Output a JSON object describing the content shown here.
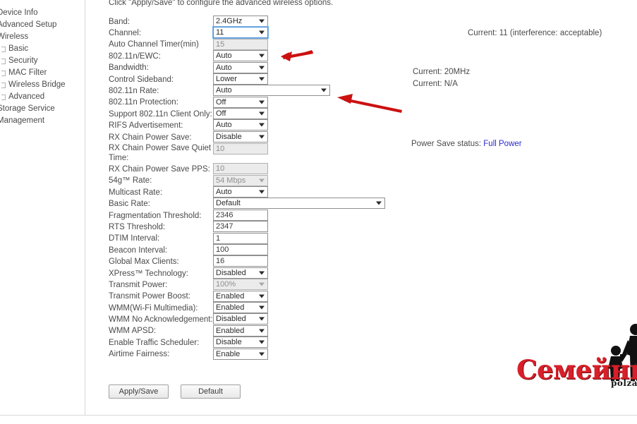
{
  "sidebar": {
    "items": [
      {
        "label": "Device Info",
        "sub": false
      },
      {
        "label": "Advanced Setup",
        "sub": false
      },
      {
        "label": "Wireless",
        "sub": false
      },
      {
        "label": "Basic",
        "sub": true
      },
      {
        "label": "Security",
        "sub": true
      },
      {
        "label": "MAC Filter",
        "sub": true
      },
      {
        "label": "Wireless Bridge",
        "sub": true
      },
      {
        "label": "Advanced",
        "sub": true
      },
      {
        "label": "Storage Service",
        "sub": false
      },
      {
        "label": "Management",
        "sub": false
      }
    ]
  },
  "main": {
    "intro": "Click \"Apply/Save\" to configure the advanced wireless options.",
    "notes": {
      "channel_current": "Current: 11 (interference: acceptable)",
      "bandwidth_current": "Current: 20MHz",
      "sideband_current": "Current: N/A",
      "power_save_prefix": "Power Save status: ",
      "power_save_link": "Full Power"
    },
    "fields": [
      {
        "label": "Band:",
        "type": "select",
        "value": "2.4GHz",
        "width": "normal",
        "state": "normal"
      },
      {
        "label": "Channel:",
        "type": "select",
        "value": "11",
        "width": "normal",
        "state": "focused"
      },
      {
        "label": "Auto Channel Timer(min)",
        "type": "input",
        "value": "15",
        "width": "normal",
        "state": "disabled"
      },
      {
        "label": "802.11n/EWC:",
        "type": "select",
        "value": "Auto",
        "width": "normal",
        "state": "normal"
      },
      {
        "label": "Bandwidth:",
        "type": "select",
        "value": "Auto",
        "width": "normal",
        "state": "normal"
      },
      {
        "label": "Control Sideband:",
        "type": "select",
        "value": "Lower",
        "width": "normal",
        "state": "normal"
      },
      {
        "label": "802.11n Rate:",
        "type": "select",
        "value": "Auto",
        "width": "wide",
        "state": "normal"
      },
      {
        "label": "802.11n Protection:",
        "type": "select",
        "value": "Off",
        "width": "normal",
        "state": "normal"
      },
      {
        "label": "Support 802.11n Client Only:",
        "type": "select",
        "value": "Off",
        "width": "normal",
        "state": "normal"
      },
      {
        "label": "RIFS Advertisement:",
        "type": "select",
        "value": "Auto",
        "width": "normal",
        "state": "normal"
      },
      {
        "label": "RX Chain Power Save:",
        "type": "select",
        "value": "Disable",
        "width": "normal",
        "state": "normal"
      },
      {
        "label": "RX Chain Power Save Quiet\nTime:",
        "type": "input",
        "value": "10",
        "width": "normal",
        "state": "disabled",
        "tall": true
      },
      {
        "label": "RX Chain Power Save PPS:",
        "type": "input",
        "value": "10",
        "width": "normal",
        "state": "disabled"
      },
      {
        "label": "54g™ Rate:",
        "type": "select",
        "value": "54 Mbps",
        "width": "normal",
        "state": "disabled"
      },
      {
        "label": "Multicast Rate:",
        "type": "select",
        "value": "Auto",
        "width": "normal",
        "state": "normal"
      },
      {
        "label": "Basic Rate:",
        "type": "select",
        "value": "Default",
        "width": "wider",
        "state": "normal"
      },
      {
        "label": "Fragmentation Threshold:",
        "type": "input",
        "value": "2346",
        "width": "normal",
        "state": "normal"
      },
      {
        "label": "RTS Threshold:",
        "type": "input",
        "value": "2347",
        "width": "normal",
        "state": "normal"
      },
      {
        "label": "DTIM Interval:",
        "type": "input",
        "value": "1",
        "width": "normal",
        "state": "normal"
      },
      {
        "label": "Beacon Interval:",
        "type": "input",
        "value": "100",
        "width": "normal",
        "state": "normal"
      },
      {
        "label": "Global Max Clients:",
        "type": "input",
        "value": "16",
        "width": "normal",
        "state": "normal"
      },
      {
        "label": "XPress™ Technology:",
        "type": "select",
        "value": "Disabled",
        "width": "normal",
        "state": "normal"
      },
      {
        "label": "Transmit Power:",
        "type": "select",
        "value": "100%",
        "width": "normal",
        "state": "disabled"
      },
      {
        "label": "Transmit Power Boost:",
        "type": "select",
        "value": "Enabled",
        "width": "normal",
        "state": "normal"
      },
      {
        "label": "WMM(Wi-Fi Multimedia):",
        "type": "select",
        "value": "Enabled",
        "width": "normal",
        "state": "normal"
      },
      {
        "label": "WMM No Acknowledgement:",
        "type": "select",
        "value": "Disabled",
        "width": "normal",
        "state": "normal"
      },
      {
        "label": "WMM APSD:",
        "type": "select",
        "value": "Enabled",
        "width": "normal",
        "state": "normal"
      },
      {
        "label": "Enable Traffic Scheduler:",
        "type": "select",
        "value": "Disable",
        "width": "normal",
        "state": "normal"
      },
      {
        "label": "Airtime Fairness:",
        "type": "select",
        "value": "Enable",
        "width": "normal",
        "state": "normal"
      }
    ],
    "buttons": {
      "apply_save": "Apply/Save",
      "default": "Default"
    }
  },
  "watermark": {
    "title": "Семейный Очаг",
    "url": "polzablog.ru"
  },
  "colors": {
    "accent_red": "#d8202a",
    "link_blue": "#2a2ad0",
    "focus_blue": "#4a90d9",
    "text": "#4a4a4a"
  }
}
